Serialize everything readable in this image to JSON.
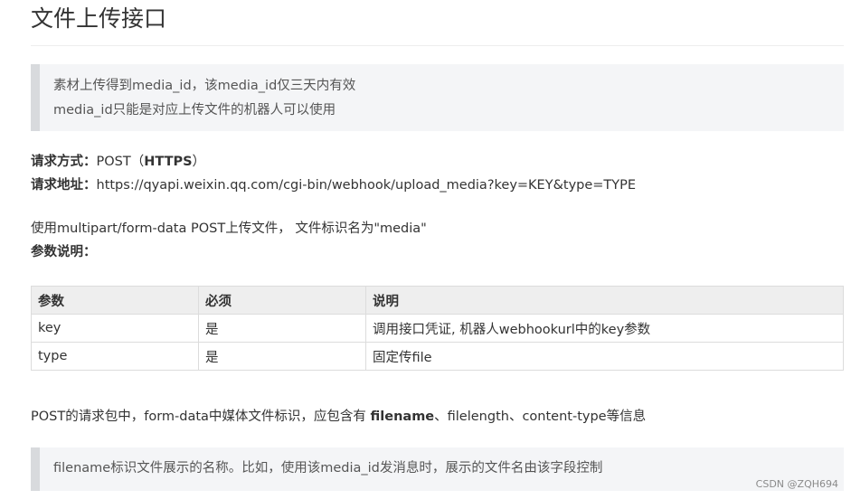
{
  "title": "文件上传接口",
  "notice1": {
    "line1": "素材上传得到media_id，该media_id仅三天内有效",
    "line2": "media_id只能是对应上传文件的机器人可以使用"
  },
  "request": {
    "method_label": "请求方式：",
    "method_prefix": "POST（",
    "method_bold": "HTTPS",
    "method_suffix": "）",
    "url_label": "请求地址：",
    "url": "https://qyapi.weixin.qq.com/cgi-bin/webhook/upload_media?key=KEY&type=TYPE"
  },
  "usage": "使用multipart/form-data POST上传文件， 文件标识名为\"media\"",
  "params_label": "参数说明：",
  "table": {
    "headers": [
      "参数",
      "必须",
      "说明"
    ],
    "rows": [
      [
        "key",
        "是",
        "调用接口凭证, 机器人webhookurl中的key参数"
      ],
      [
        "type",
        "是",
        "固定传file"
      ]
    ]
  },
  "post_note": {
    "prefix": "POST的请求包中，form-data中媒体文件标识，应包含有 ",
    "bold": "filename",
    "suffix": "、filelength、content-type等信息"
  },
  "notice2": {
    "line1": "filename标识文件展示的名称。比如，使用该media_id发消息时，展示的文件名由该字段控制"
  },
  "watermark": "CSDN @ZQH694"
}
